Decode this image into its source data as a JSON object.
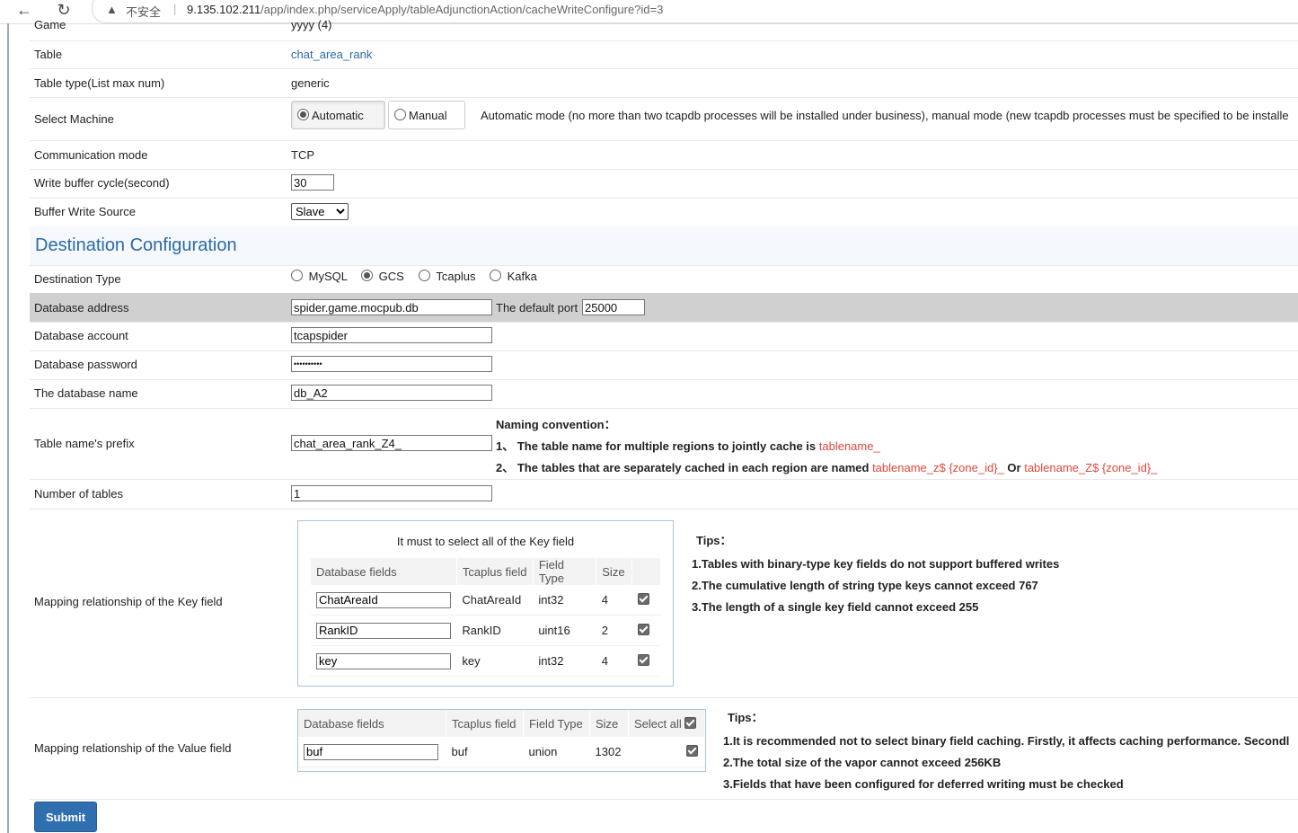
{
  "browser": {
    "back_icon": "back-arrow-icon",
    "reload_icon": "reload-icon",
    "insecure_label": "不安全",
    "url_host": "9.135.102.211",
    "url_path": "/app/index.php/serviceApply/tableAdjunctionAction/cacheWriteConfigure?id=3"
  },
  "form": {
    "game_label": "Game",
    "game_value": "yyyy (4)",
    "table_label": "Table",
    "table_value": "chat_area_rank",
    "table_type_label": "Table type(List max num)",
    "table_type_value": "generic",
    "select_machine_label": "Select Machine",
    "machine_options": [
      "Automatic",
      "Manual"
    ],
    "machine_selected": "Automatic",
    "machine_note": "Automatic mode (no more than two tcapdb processes will be installed under business), manual mode (new tcapdb processes must be specified to be installe",
    "comm_mode_label": "Communication mode",
    "comm_mode_value": "TCP",
    "write_cycle_label": "Write buffer cycle(second)",
    "write_cycle_value": "30",
    "buffer_source_label": "Buffer Write Source",
    "buffer_source_value": "Slave"
  },
  "destination": {
    "section_title": "Destination Configuration",
    "type_label": "Destination Type",
    "types": [
      "MySQL",
      "GCS",
      "Tcaplus",
      "Kafka"
    ],
    "type_selected": "GCS",
    "db_address_label": "Database address",
    "db_address_value": "spider.game.mocpub.db",
    "default_port_label": "The default port",
    "default_port_value": "25000",
    "db_account_label": "Database account",
    "db_account_value": "tcapspider",
    "db_password_label": "Database password",
    "db_password_value": "••••••••••",
    "db_name_label": "The database name",
    "db_name_value": "db_A2",
    "prefix_label": "Table name's prefix",
    "prefix_value": "chat_area_rank_Z4_",
    "naming_title": "Naming convention：",
    "naming_1_text": "1、 The table name for multiple regions to jointly cache is ",
    "naming_1_red": "tablename_",
    "naming_2_text": "2、 The tables that are separately cached in each region are named ",
    "naming_2_red_a": "tablename_z$ {zone_id}_",
    "naming_2_or": " Or ",
    "naming_2_red_b": "tablename_Z$ {zone_id}_",
    "num_tables_label": "Number of tables",
    "num_tables_value": "1"
  },
  "key_mapping": {
    "label": "Mapping relationship of the Key field",
    "caption": "It must to select all of the Key field",
    "headers": [
      "Database fields",
      "Tcaplus field",
      "Field Type",
      "Size"
    ],
    "rows": [
      {
        "db_field": "ChatAreaId",
        "tcaplus_field": "ChatAreaId",
        "type": "int32",
        "size": "4",
        "checked": true
      },
      {
        "db_field": "RankID",
        "tcaplus_field": "RankID",
        "type": "uint16",
        "size": "2",
        "checked": true
      },
      {
        "db_field": "key",
        "tcaplus_field": "key",
        "type": "int32",
        "size": "4",
        "checked": true
      }
    ],
    "tips_title": "Tips：",
    "tips": [
      "1.Tables with binary-type key fields do not support buffered writes",
      "2.The cumulative length of string type keys cannot exceed 767",
      "3.The length of a single key field cannot exceed 255"
    ]
  },
  "value_mapping": {
    "label": "Mapping relationship of the Value field",
    "headers": [
      "Database fields",
      "Tcaplus field",
      "Field Type",
      "Size",
      "Select all"
    ],
    "rows": [
      {
        "db_field": "buf",
        "tcaplus_field": "buf",
        "type": "union",
        "size": "1302",
        "checked": true
      }
    ],
    "tips_title": "Tips：",
    "tips": [
      "1.It is recommended not to select binary field caching. Firstly, it affects caching performance. Secondl",
      "2.The total size of the vapor cannot exceed 256KB",
      "3.Fields that have been configured for deferred writing must be checked"
    ]
  },
  "submit_label": "Submit"
}
